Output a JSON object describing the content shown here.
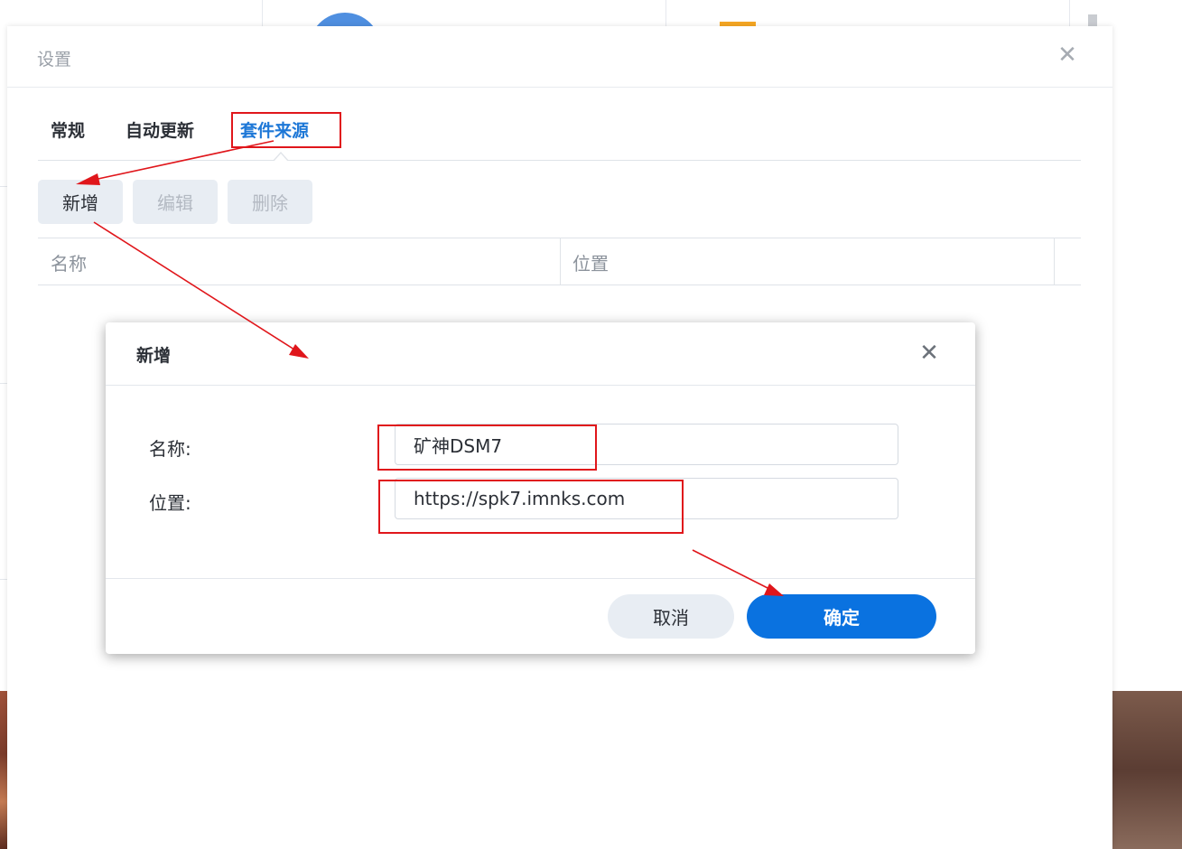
{
  "settings": {
    "title": "设置",
    "close_icon": "close-icon",
    "tabs": [
      {
        "label": "常规",
        "active": false
      },
      {
        "label": "自动更新",
        "active": false
      },
      {
        "label": "套件来源",
        "active": true
      }
    ],
    "toolbar": {
      "add_label": "新增",
      "edit_label": "编辑",
      "delete_label": "删除"
    },
    "grid_columns": [
      "名称",
      "位置"
    ]
  },
  "dialog": {
    "title": "新增",
    "close_icon": "close-icon",
    "name_label": "名称:",
    "name_value": "矿神DSM7",
    "location_label": "位置:",
    "location_value": "https://spk7.imnks.com",
    "cancel_label": "取消",
    "ok_label": "确定"
  },
  "colors": {
    "accent": "#0a72e0",
    "active_tab": "#1e78d7",
    "annotation": "#e0161b"
  }
}
